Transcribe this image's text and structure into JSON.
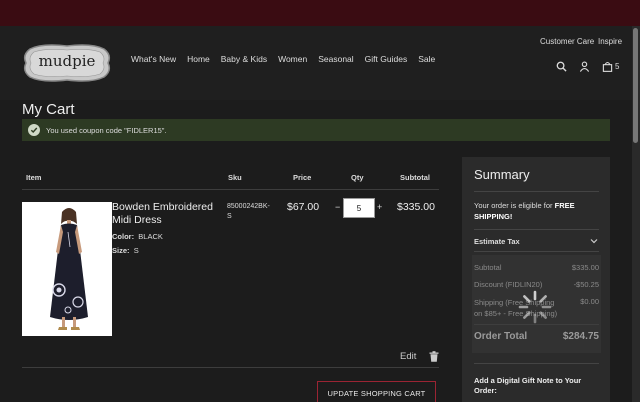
{
  "header": {
    "logo_text": "mudpie",
    "nav": [
      "What's New",
      "Home",
      "Baby & Kids",
      "Women",
      "Seasonal",
      "Gift Guides",
      "Sale"
    ],
    "customer_care": "Customer Care",
    "inspire": "Inspire",
    "cart_count": "5"
  },
  "page": {
    "title": "My Cart",
    "coupon_message": "You used coupon code \"FIDLER15\"."
  },
  "table": {
    "headers": {
      "item": "Item",
      "sku": "Sku",
      "price": "Price",
      "qty": "Qty",
      "subtotal": "Subtotal"
    },
    "row": {
      "name": "Bowden Embroidered Midi Dress",
      "color_label": "Color:",
      "color_value": "BLACK",
      "size_label": "Size:",
      "size_value": "S",
      "sku": "85000242BK-S",
      "price": "$67.00",
      "qty": "5",
      "qty_minus": "−",
      "qty_plus": "+",
      "subtotal": "$335.00"
    },
    "edit_label": "Edit",
    "update_label": "UPDATE SHOPPING CART"
  },
  "summary": {
    "title": "Summary",
    "ship_prefix": "Your order is eligible for ",
    "ship_bold": "FREE SHIPPING!",
    "estimate_tax": "Estimate Tax",
    "rows": [
      {
        "label": "Subtotal",
        "value": "$335.00"
      },
      {
        "label": "Discount (FIDLIN20)",
        "value": "-$50.25"
      },
      {
        "label": "Shipping (Free Shipping on $85+ - Free Shipping)",
        "value": "$0.00"
      }
    ],
    "order_total_label": "Order Total",
    "order_total_value": "$284.75",
    "gift_note": "Add a Digital Gift Note to Your Order:"
  },
  "colors": {
    "topbar": "#3a0c12",
    "accent_border": "#9b2433",
    "coupon_bg": "#2d3a23"
  }
}
